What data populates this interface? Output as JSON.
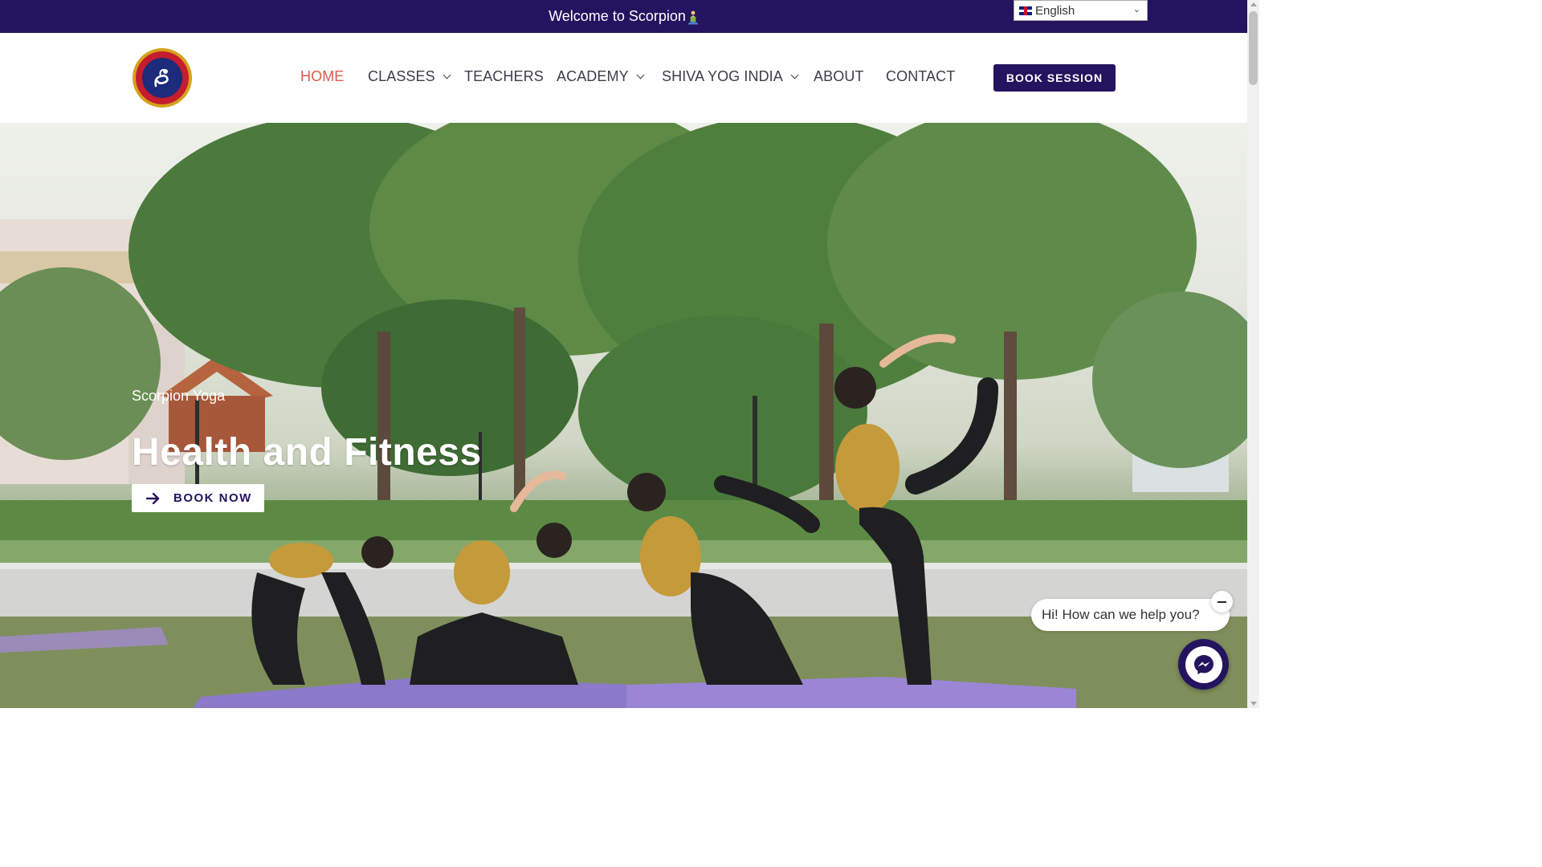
{
  "topbar": {
    "welcome_text": "Welcome to Scorpion",
    "language": {
      "selected": "English",
      "icon": "uk-flag-icon"
    }
  },
  "header": {
    "logo_alt": "SCORPION YOGA",
    "nav": [
      {
        "label": "HOME",
        "active": true,
        "has_dropdown": false
      },
      {
        "label": "CLASSES",
        "active": false,
        "has_dropdown": true
      },
      {
        "label": "TEACHERS",
        "active": false,
        "has_dropdown": false
      },
      {
        "label": "ACADEMY",
        "active": false,
        "has_dropdown": true
      },
      {
        "label": "SHIVA YOG INDIA",
        "active": false,
        "has_dropdown": true
      },
      {
        "label": "ABOUT",
        "active": false,
        "has_dropdown": false
      },
      {
        "label": "CONTACT",
        "active": false,
        "has_dropdown": false
      }
    ],
    "cta_label": "BOOK SESSION"
  },
  "hero": {
    "kicker": "Scorpion Yoga",
    "title": "Health and Fitness",
    "button_label": "BOOK NOW"
  },
  "chat": {
    "greeting": "Hi! How can we help you?"
  },
  "colors": {
    "brand": "#24145f",
    "nav_active": "#e0584c",
    "nav_text": "#3d3d4a"
  }
}
